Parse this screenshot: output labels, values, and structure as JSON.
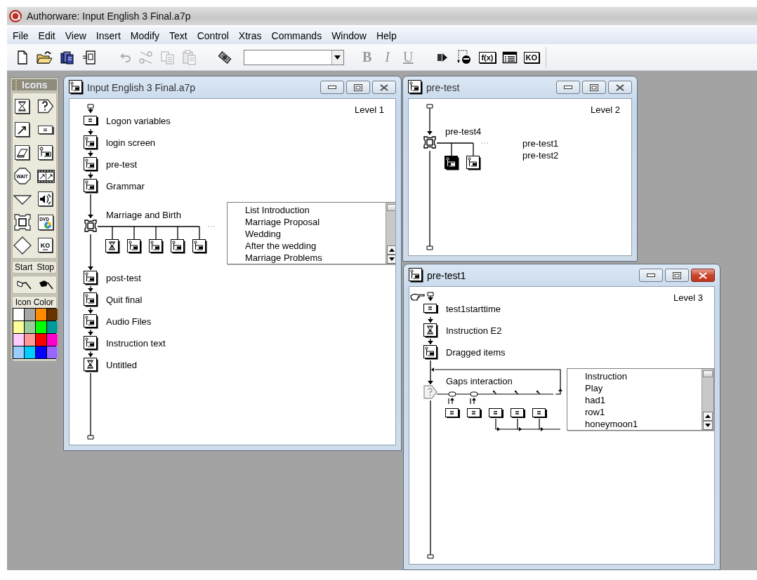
{
  "app": {
    "title": "Authorware: Input English 3 Final.a7p"
  },
  "menu": [
    "File",
    "Edit",
    "View",
    "Insert",
    "Modify",
    "Text",
    "Control",
    "Xtras",
    "Commands",
    "Window",
    "Help"
  ],
  "toolbar": [
    {
      "kind": "new",
      "disabled": false
    },
    {
      "kind": "open",
      "disabled": false
    },
    {
      "kind": "import",
      "disabled": false
    },
    {
      "kind": "library",
      "disabled": false
    },
    {
      "kind": "undo",
      "disabled": true
    },
    {
      "kind": "cut",
      "disabled": true
    },
    {
      "kind": "copy",
      "disabled": true
    },
    {
      "kind": "paste",
      "disabled": true
    },
    {
      "kind": "media",
      "disabled": false
    },
    {
      "kind": "combo",
      "disabled": false
    },
    {
      "kind": "style",
      "text": "B",
      "disabled": true
    },
    {
      "kind": "style",
      "text": "I",
      "disabled": true
    },
    {
      "kind": "style",
      "text": "U",
      "disabled": true
    },
    {
      "kind": "run",
      "disabled": false
    },
    {
      "kind": "trace",
      "disabled": false
    },
    {
      "kind": "boxed",
      "text": "f(x)",
      "disabled": false
    },
    {
      "kind": "variables",
      "disabled": false
    },
    {
      "kind": "boxed",
      "text": "KO",
      "disabled": false
    }
  ],
  "palette": {
    "title": "Icons",
    "icons": [
      {
        "kind": "display"
      },
      {
        "kind": "decision"
      },
      {
        "kind": "motion"
      },
      {
        "kind": "calc"
      },
      {
        "kind": "erase"
      },
      {
        "kind": "map"
      },
      {
        "kind": "wait",
        "text": "WAIT"
      },
      {
        "kind": "movie"
      },
      {
        "kind": "navigate"
      },
      {
        "kind": "sound"
      },
      {
        "kind": "framework"
      },
      {
        "kind": "dvd",
        "text": "DVD"
      },
      {
        "kind": "interaction"
      },
      {
        "kind": "knowledge",
        "text": "KO"
      }
    ],
    "flags": [
      "Start",
      "Stop"
    ],
    "color_title": "Icon Color",
    "colors": [
      {
        "color": "#ffffff"
      },
      {
        "color": "#a6a6a6"
      },
      {
        "color": "#ff8c00"
      },
      {
        "color": "#663300"
      },
      {
        "color": "#ffff99"
      },
      {
        "color": "#99cc99"
      },
      {
        "color": "#00ff00"
      },
      {
        "color": "#009999"
      },
      {
        "color": "#ffccff"
      },
      {
        "color": "#ff9999"
      },
      {
        "color": "#ff0000"
      },
      {
        "color": "#ff00cc"
      },
      {
        "color": "#99ccff"
      },
      {
        "color": "#00ccff"
      },
      {
        "color": "#0000ff"
      },
      {
        "color": "#9966ff"
      }
    ]
  },
  "windows": [
    {
      "title": "Input English 3 Final.a7p",
      "level": "Level 1",
      "active": false,
      "nodes": [
        {
          "kind": "calc",
          "label": "Logon variables"
        },
        {
          "kind": "map",
          "label": "login screen"
        },
        {
          "kind": "map",
          "label": "pre-test"
        },
        {
          "kind": "map",
          "label": "Grammar"
        },
        {
          "kind": "framework",
          "label": "Marriage and Birth",
          "children": [
            {
              "kind": "display",
              "selected": false
            },
            {
              "kind": "map",
              "selected": false
            },
            {
              "kind": "map",
              "selected": false
            },
            {
              "kind": "map",
              "selected": false
            },
            {
              "kind": "map",
              "selected": false
            }
          ],
          "pages": {
            "kind": "listbox",
            "items": [
              "List Introduction",
              "Marriage Proposal",
              "Wedding",
              "After the wedding",
              "Marriage Problems"
            ]
          }
        },
        {
          "kind": "map",
          "label": "post-test"
        },
        {
          "kind": "map",
          "label": "Quit final"
        },
        {
          "kind": "map",
          "label": " Audio Files"
        },
        {
          "kind": "map",
          "label": "Instruction text"
        },
        {
          "kind": "display",
          "label": "Untitled"
        }
      ]
    },
    {
      "title": "pre-test",
      "level": "Level 2",
      "active": false,
      "nodes": [
        {
          "kind": "framework",
          "label": "pre-test4",
          "children": [
            {
              "kind": "map",
              "selected": true
            },
            {
              "kind": "map",
              "selected": false
            }
          ],
          "pages": {
            "kind": "plain",
            "items": [
              "pre-test1",
              "pre-test2"
            ]
          }
        }
      ]
    },
    {
      "title": "pre-test1",
      "level": "Level 3",
      "active": true,
      "pointer": true,
      "nodes": [
        {
          "kind": "calc",
          "label": "test1starttime"
        },
        {
          "kind": "display",
          "label": "Instruction E2"
        },
        {
          "kind": "map",
          "label": "Dragged items"
        },
        {
          "kind": "interaction",
          "label": "Gaps interaction",
          "children": [
            {
              "kind": "calc",
              "button_response": true,
              "exits": true
            },
            {
              "kind": "calc",
              "button_response": true,
              "exits": true
            },
            {
              "kind": "calc",
              "button_response": false,
              "exits": false
            },
            {
              "kind": "calc",
              "button_response": false,
              "exits": false
            },
            {
              "kind": "calc",
              "button_response": false,
              "exits": false
            }
          ],
          "pages": {
            "kind": "listbox",
            "items": [
              "Instruction",
              "Play",
              "had1",
              "row1",
              "honeymoon1"
            ]
          }
        }
      ]
    }
  ]
}
